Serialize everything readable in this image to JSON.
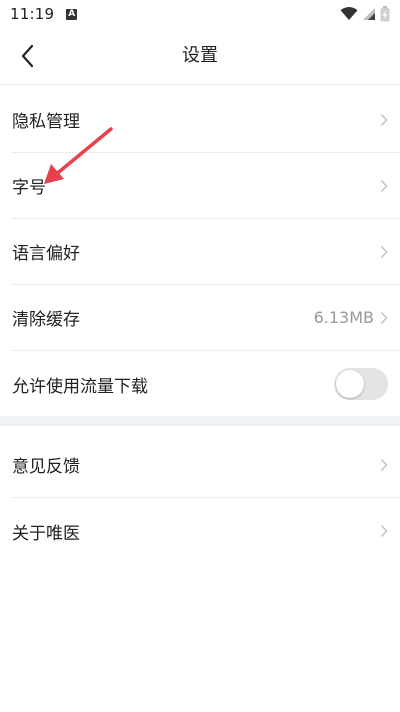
{
  "status_bar": {
    "time": "11:19",
    "notification_icon": "A"
  },
  "header": {
    "title": "设置",
    "back_icon": "chevron-left-icon"
  },
  "settings": {
    "items": [
      {
        "label": "隐私管理"
      },
      {
        "label": "字号"
      },
      {
        "label": "语言偏好"
      },
      {
        "label": "清除缓存",
        "value": "6.13MB"
      },
      {
        "label": "允许使用流量下载",
        "toggle": false
      }
    ]
  },
  "other": {
    "items": [
      {
        "label": "意见反馈"
      },
      {
        "label": "关于唯医"
      }
    ]
  },
  "colors": {
    "annotation_arrow": "#e9414b",
    "toggle_off": "#e3e3e3",
    "divider": "#ececec",
    "section_gap": "#f0f3f6"
  }
}
